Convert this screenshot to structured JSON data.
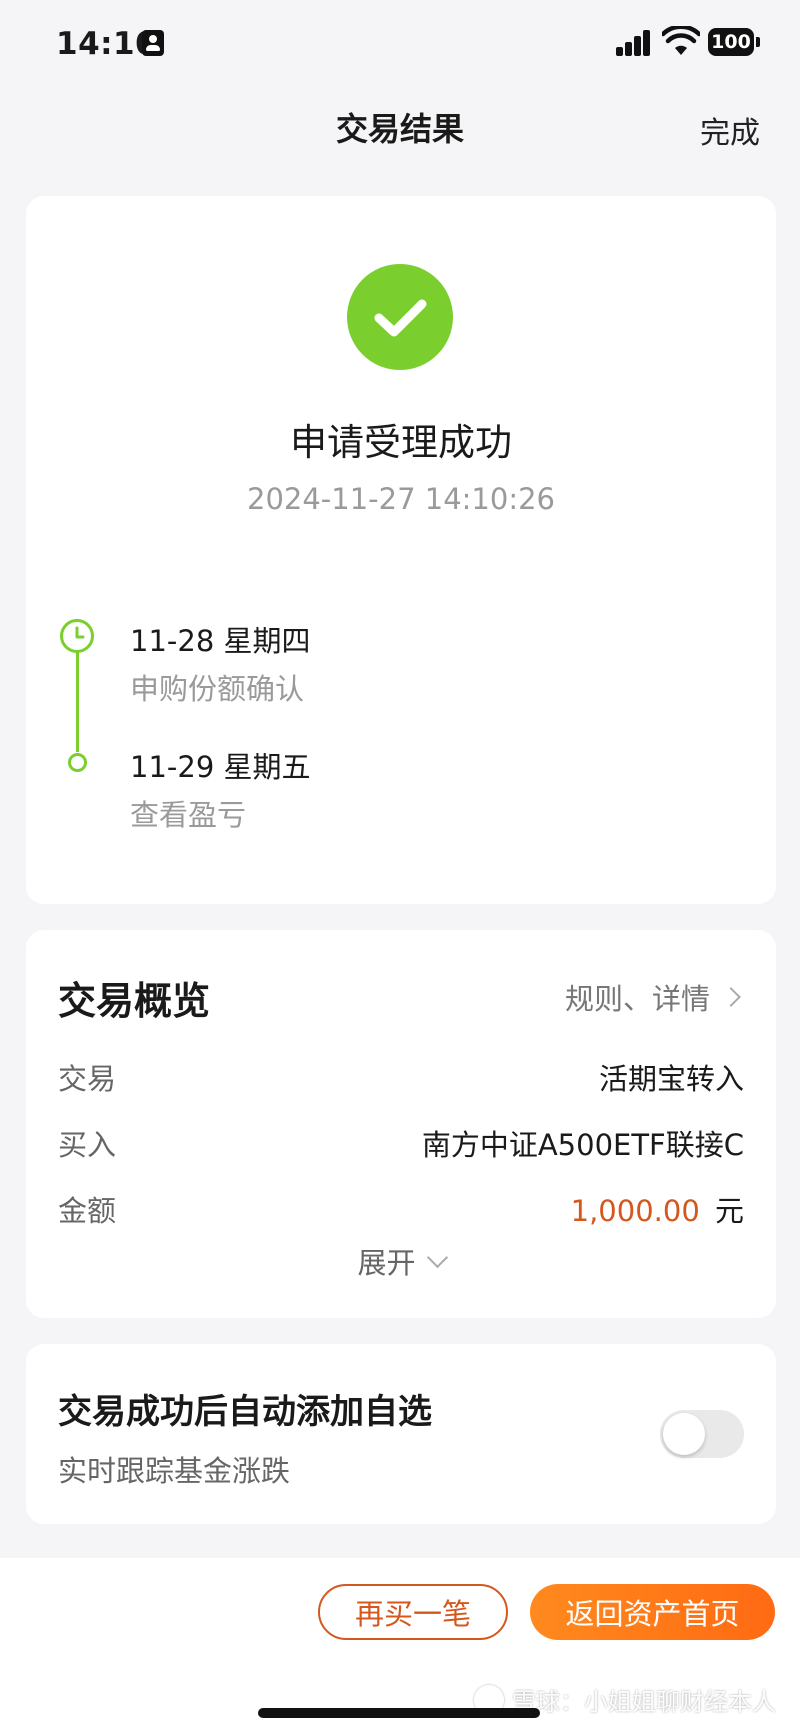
{
  "status_bar": {
    "time": "14:10",
    "battery": "100"
  },
  "nav": {
    "title": "交易结果",
    "done": "完成"
  },
  "result": {
    "title": "申请受理成功",
    "timestamp": "2024-11-27 14:10:26",
    "steps": [
      {
        "date": "11-28  星期四",
        "desc": "申购份额确认"
      },
      {
        "date": "11-29  星期五",
        "desc": "查看盈亏"
      }
    ]
  },
  "overview": {
    "title": "交易概览",
    "link": "规则、详情",
    "rows": [
      {
        "label": "交易",
        "value": "活期宝转入"
      },
      {
        "label": "买入",
        "value": "南方中证A500ETF联接C"
      },
      {
        "label": "金额",
        "amount": "1,000.00",
        "unit": "元"
      }
    ],
    "expand": "展开"
  },
  "auto_add": {
    "title": "交易成功后自动添加自选",
    "subtitle": "实时跟踪基金涨跌",
    "enabled": false
  },
  "actions": {
    "buy_again": "再买一笔",
    "back_home": "返回资产首页"
  },
  "watermark": "雪球：小姐姐聊财经本人",
  "colors": {
    "success": "#7acf2e",
    "accent": "#ff6a12",
    "amount": "#d4581e"
  }
}
